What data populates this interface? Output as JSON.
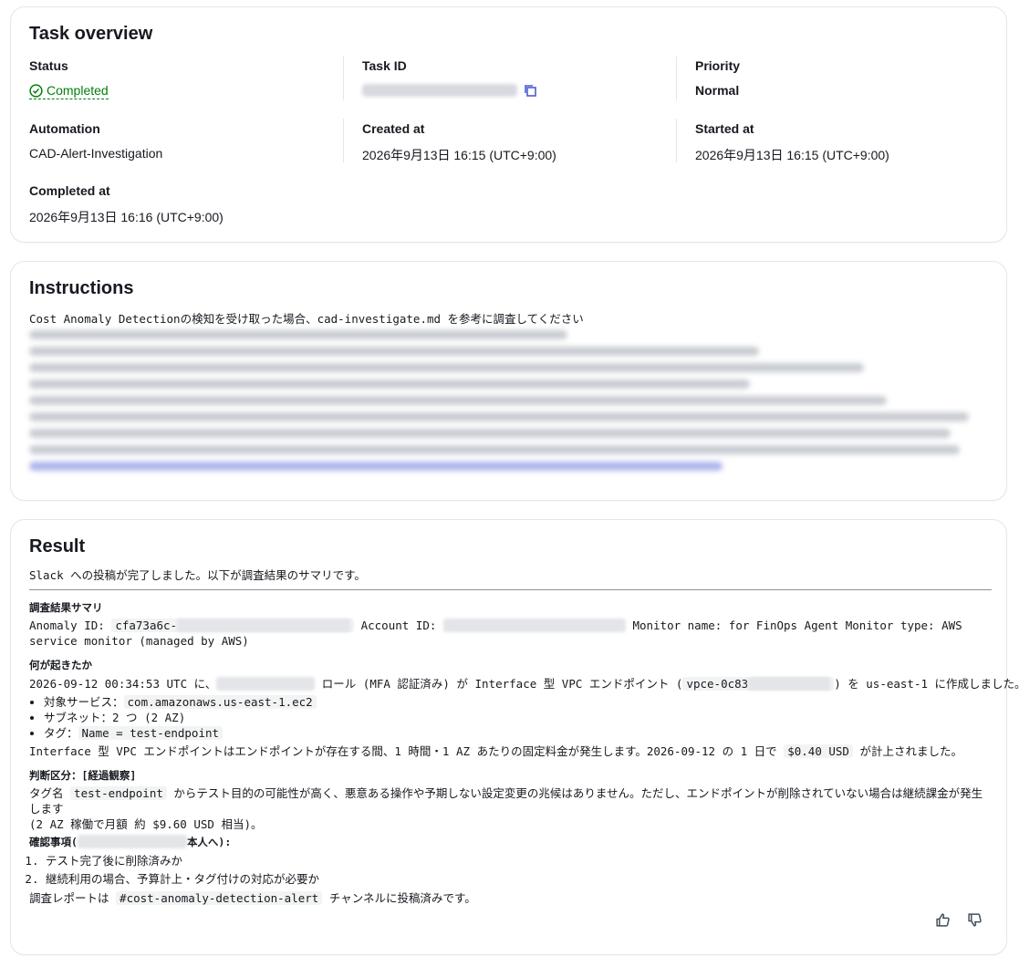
{
  "overview": {
    "title": "Task overview",
    "status_label": "Status",
    "status_value": "Completed",
    "task_id_label": "Task ID",
    "priority_label": "Priority",
    "priority_value": "Normal",
    "automation_label": "Automation",
    "automation_value": "CAD-Alert-Investigation",
    "created_label": "Created at",
    "created_value": "2026年9月13日 16:15 (UTC+9:00)",
    "started_label": "Started at",
    "started_value": "2026年9月13日 16:15 (UTC+9:00)",
    "completed_label": "Completed at",
    "completed_value": "2026年9月13日 16:16 (UTC+9:00)"
  },
  "instructions": {
    "title": "Instructions",
    "first_line": "Cost Anomaly Detectionの検知を受け取った場合、cad-investigate.md を参考に調査してください"
  },
  "result": {
    "title": "Result",
    "intro": "Slack への投稿が完了しました。以下が調査結果のサマリです。",
    "summary_heading": "調査結果サマリ",
    "anomaly_label": "Anomaly ID:",
    "anomaly_prefix": "cfa73a6c-",
    "account_label": "Account ID:",
    "monitor_text": "Monitor name: for FinOps Agent Monitor type: AWS",
    "monitor_text2": "service monitor (managed by AWS)",
    "what_heading": "何が起きたか",
    "what_line_a": "2026-09-12 00:34:53 UTC に、",
    "what_line_b": "ロール (MFA 認証済み) が Interface 型 VPC エンドポイント (",
    "vpce_prefix": "vpce-0c83",
    "what_line_c": ") を us-east-1 に作成しました。",
    "bullet1_label": "対象サービス：",
    "bullet1_code": "com.amazonaws.us-east-1.ec2",
    "bullet2": "サブネット：2 つ (2 AZ)",
    "bullet3_label": "タグ：",
    "bullet3_code": "Name = test-endpoint",
    "fee_a": "Interface 型 VPC エンドポイントはエンドポイントが存在する間、1 時間・1 AZ あたりの固定料金が発生します。2026-09-12 の 1 日で",
    "fee_code": "$0.40 USD",
    "fee_b": "が計上されました。",
    "judge_heading": "判断区分：[経過観察]",
    "judge_a": "タグ名",
    "judge_code": "test-endpoint",
    "judge_b": "からテスト目的の可能性が高く、悪意ある操作や予期しない設定変更の兆候はありません。ただし、エンドポイントが削除されていない場合は継続課金が発生します",
    "judge_c": "(2 AZ 稼働で月額 約 $9.60 USD 相当)。",
    "confirm_a": "確認事項(",
    "confirm_b": "本人へ):",
    "item1": "テスト完了後に削除済みか",
    "item2": "継続利用の場合、予算計上・タグ付けの対応が必要か",
    "report_a": "調査レポートは",
    "report_code": "#cost-anomaly-detection-alert",
    "report_b": "チャンネルに投稿済みです。"
  }
}
